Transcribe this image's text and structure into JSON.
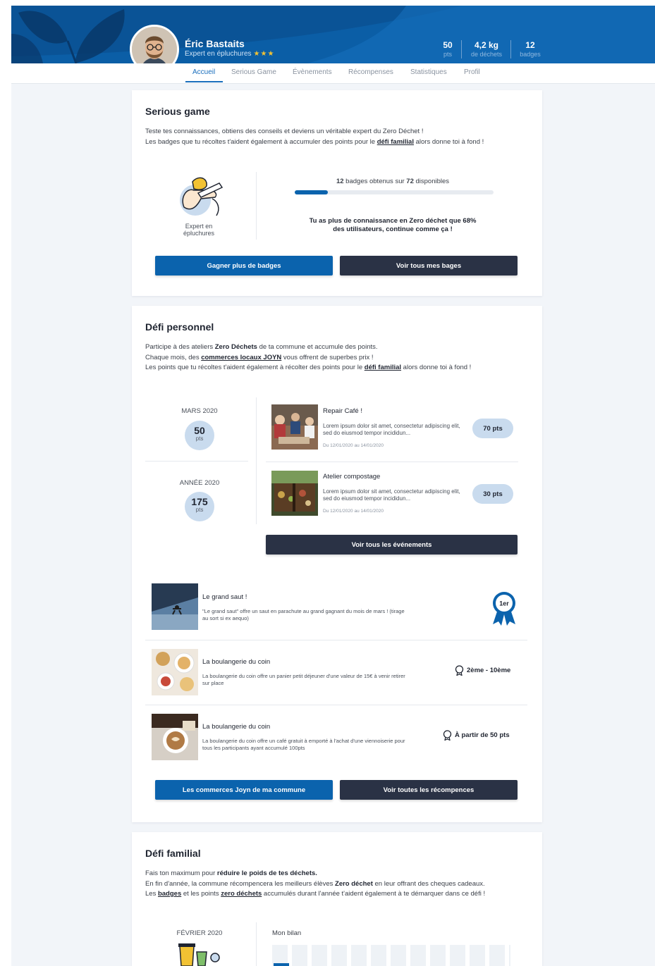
{
  "header": {
    "user_name": "Éric Bastaits",
    "user_rank": "Expert en épluchures",
    "rank_stars": "★★★",
    "stats": [
      {
        "value": "50",
        "label": "pts"
      },
      {
        "value": "4,2 kg",
        "label": "de déchets"
      },
      {
        "value": "12",
        "label": "badges"
      }
    ],
    "brand_color": "#0b63ad"
  },
  "nav": {
    "tabs": [
      "Accueil",
      "Serious Game",
      "Évènements",
      "Récompenses",
      "Statistiques",
      "Profil"
    ],
    "active": "Accueil"
  },
  "serious_game": {
    "title": "Serious game",
    "intro_line1": "Teste tes connaissances, obtiens des conseils et deviens un véritable expert du Zero Déchet !",
    "intro_line2_pre": "Les badges que tu récoltes t'aident également à accumuler des points pour le ",
    "intro_line2_link": "défi familial",
    "intro_line2_post": " alors donne toi à fond !",
    "badge_label": "Expert en épluchures",
    "progress_obtained": "12",
    "progress_mid": " badges obtenus sur ",
    "progress_total": "72",
    "progress_post": " disponibles",
    "progress_fraction": 0.1667,
    "compare_line1": "Tu as plus de connaissance en Zero déchet que 68%",
    "compare_line2": "des utilisateurs, continue comme ça !",
    "btn_more": "Gagner plus de badges",
    "btn_all": "Voir tous mes bages"
  },
  "defi_personnel": {
    "title": "Défi personnel",
    "l1_pre": "Participe à des ateliers ",
    "l1_bold": "Zero Déchets",
    "l1_post": " de ta commune et accumule des points.",
    "l2_pre": "Chaque mois, des ",
    "l2_link": "commerces locaux JOYN",
    "l2_post": " vous offrent de superbes prix !",
    "l3_pre": "Les points que tu récoltes t'aident également à récolter des points pour le ",
    "l3_link": "défi familial",
    "l3_post": " alors donne toi à fond !",
    "periods": [
      {
        "label": "MARS 2020",
        "points": "50",
        "unit": "pts"
      },
      {
        "label": "ANNÉE 2020",
        "points": "175",
        "unit": "pts"
      }
    ],
    "events": [
      {
        "title": "Repair Café !",
        "desc": "Lorem ipsum dolor sit amet, consectetur adipiscing elit, sed do eiusmod tempor incididun...",
        "date": "Du 12/01/2020 au 14/01/2020",
        "points": "70 pts"
      },
      {
        "title": "Atelier compostage",
        "desc": "Lorem ipsum dolor sit amet, consectetur adipiscing elit, sed do eiusmod tempor incididun...",
        "date": "Du 12/01/2020 au 14/01/2020",
        "points": "30 pts"
      }
    ],
    "btn_events": "Voir tous les événements",
    "rewards": [
      {
        "title": "Le grand saut !",
        "desc": "\"Le grand saut\" offre un saut en parachute au grand gagnant du mois de mars ! (tirage au sort si ex aequo)",
        "rank": "1er"
      },
      {
        "title": "La boulangerie du coin",
        "desc": "La boulangerie du coin offre un panier petit déjeuner d'une valeur de 15€ à venir retirer sur place",
        "rank": "2ème - 10ème"
      },
      {
        "title": "La boulangerie du coin",
        "desc": "La boulangerie du coin offre un café gratuit à emporté à l'achat d'une viennoiserie pour tous les participants ayant accumulé 100pts",
        "rank": "À partir de 50 pts"
      }
    ],
    "btn_shops": "Les commerces Joyn de ma commune",
    "btn_rewards": "Voir toutes les récompences"
  },
  "defi_familial": {
    "title": "Défi familial",
    "l1_pre": "Fais ton maximum pour ",
    "l1_bold": "réduire le poids de tes déchets.",
    "l2_pre": "En fin d'année, la commune récompencera les meilleurs élèves ",
    "l2_bold": "Zero déchet",
    "l2_post": " en leur  offrant des cheques cadeaux.",
    "l3_pre": "Les ",
    "l3_link1": "badges",
    "l3_mid": " et les points ",
    "l3_link2": "zero déchets",
    "l3_post": " accumulés durant l'année t'aident également à te démarquer dans ce défi !",
    "period": "FÉVRIER 2020",
    "bilan_label": "Mon bilan"
  }
}
